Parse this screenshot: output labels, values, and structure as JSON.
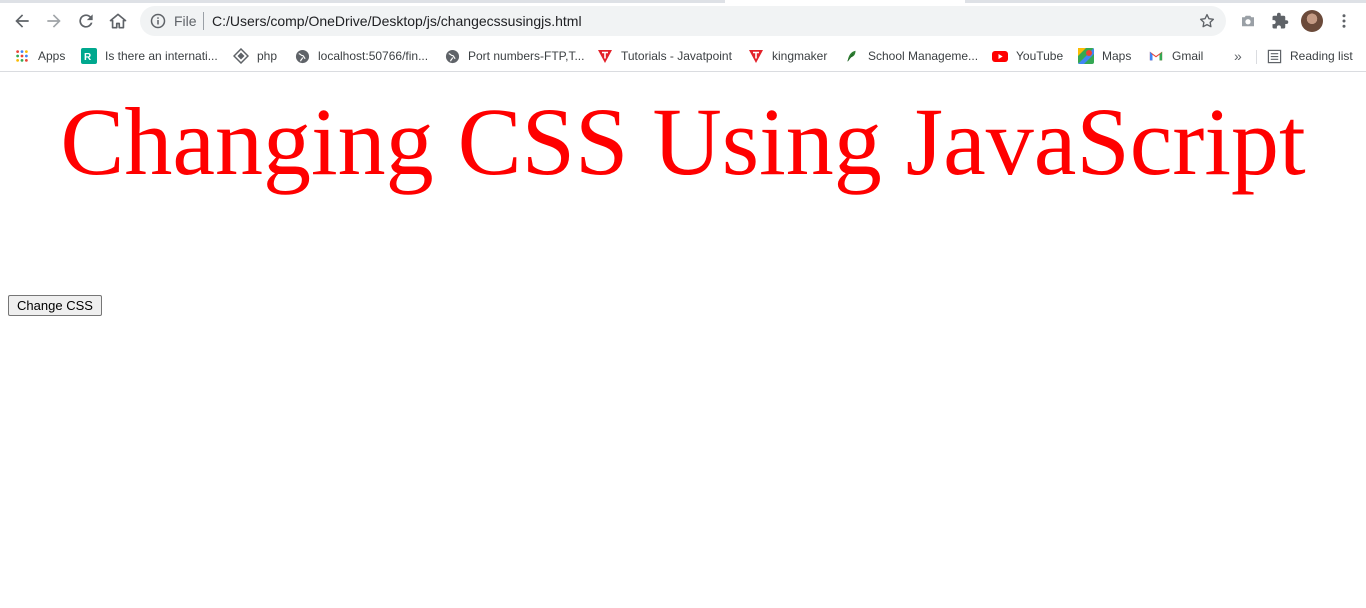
{
  "browser": {
    "omnibox": {
      "scheme_label": "File",
      "url": "C:/Users/comp/OneDrive/Desktop/js/changecssusingjs.html"
    },
    "bookmarks": [
      {
        "label": "Apps",
        "icon": "apps-grid-icon"
      },
      {
        "label": "Is there an internati...",
        "icon": "r9-icon"
      },
      {
        "label": "php",
        "icon": "diamond-icon"
      },
      {
        "label": "localhost:50766/fin...",
        "icon": "globe-icon"
      },
      {
        "label": "Port numbers-FTP,T...",
        "icon": "globe-icon"
      },
      {
        "label": "Tutorials - Javatpoint",
        "icon": "javatpoint-icon"
      },
      {
        "label": "kingmaker",
        "icon": "javatpoint-icon"
      },
      {
        "label": "School Manageme...",
        "icon": "feather-icon"
      },
      {
        "label": "YouTube",
        "icon": "youtube-icon"
      },
      {
        "label": "Maps",
        "icon": "maps-icon"
      },
      {
        "label": "Gmail",
        "icon": "gmail-icon"
      }
    ],
    "overflow_label": "»",
    "reading_list_label": "Reading list"
  },
  "page": {
    "heading": "Changing CSS Using JavaScript",
    "button_label": "Change CSS"
  },
  "colors": {
    "heading": "#ff0000",
    "omnibox_bg": "#f1f3f4"
  }
}
